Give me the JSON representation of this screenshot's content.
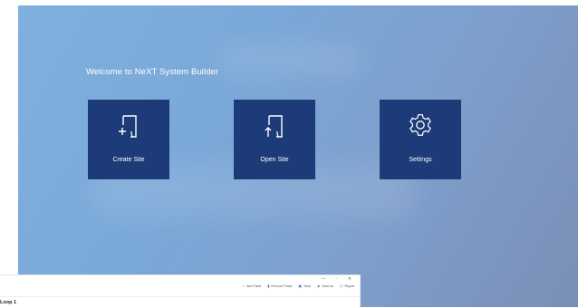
{
  "welcome_title": "Welcome to NeXT System Builder",
  "tiles": [
    {
      "label": "Create Site",
      "icon": "create-site-icon"
    },
    {
      "label": "Open Site",
      "icon": "open-site-icon"
    },
    {
      "label": "Settings",
      "icon": "gear-icon"
    }
  ],
  "colors": {
    "tile_bg": "#1c3b78",
    "bg_start": "#7fb0dd",
    "bg_end": "#7a8fb6"
  },
  "secondary_window": {
    "window_controls": "— ▫ ✕",
    "toolbar": [
      {
        "label": "Add Panel",
        "icon": "plus-icon"
      },
      {
        "label": "Remove Panel",
        "icon": "trash-icon"
      },
      {
        "label": "Save",
        "icon": "save-icon"
      },
      {
        "label": "Save as",
        "icon": "save-as-icon"
      },
      {
        "label": "Report",
        "icon": "report-icon"
      }
    ],
    "tab_label": "Loop 1"
  }
}
